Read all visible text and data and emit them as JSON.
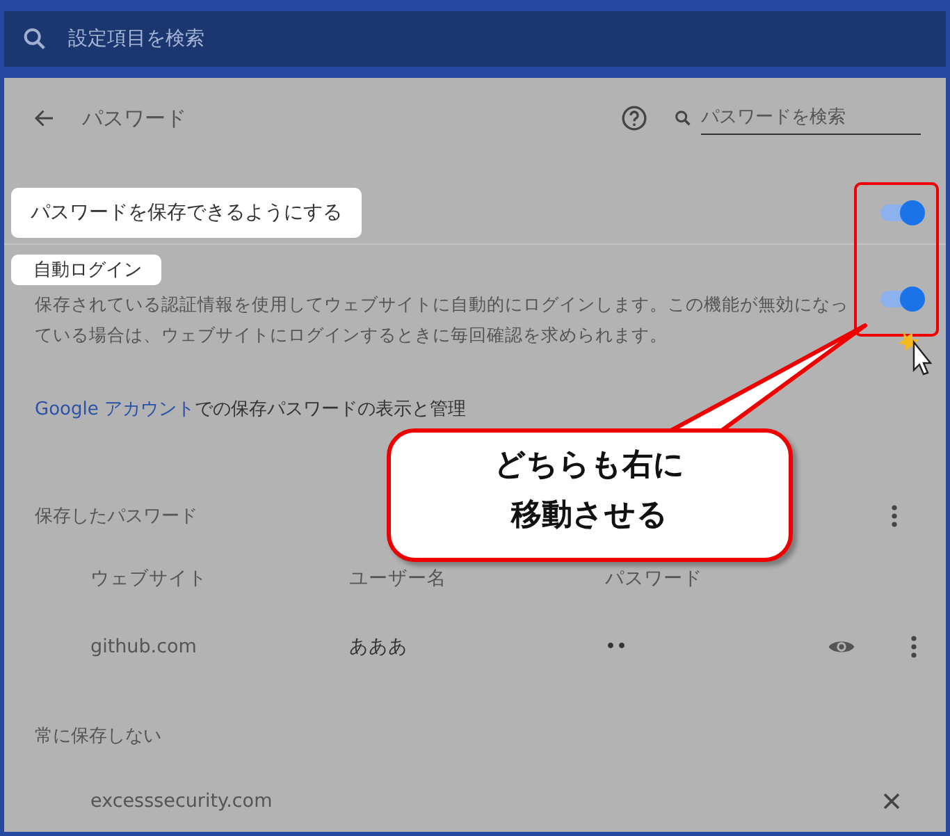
{
  "search_bar": {
    "placeholder": "設定項目を検索"
  },
  "header": {
    "title": "パスワード",
    "search": {
      "placeholder": "パスワードを検索"
    }
  },
  "settings": [
    {
      "label": "パスワードを保存できるようにする",
      "on": true
    },
    {
      "label": "自動ログイン",
      "description": "保存されている認証情報を使用してウェブサイトに自動的にログインします。この機能が無効になっている場合は、ウェブサイトにログインするときに毎回確認を求められます。",
      "on": true
    }
  ],
  "account_link": {
    "link": "Google アカウント",
    "text": "での保存パスワードの表示と管理"
  },
  "saved_passwords": {
    "title": "保存したパスワード",
    "columns": [
      "ウェブサイト",
      "ユーザー名",
      "パスワード"
    ],
    "rows": [
      {
        "website": "github.com",
        "username": "あああ",
        "password": "••"
      }
    ]
  },
  "never_saved": {
    "title": "常に保存しない",
    "sites": [
      "excesssecurity.com"
    ]
  },
  "callout": {
    "lines": [
      "どちらも右に",
      "移動させる"
    ]
  }
}
